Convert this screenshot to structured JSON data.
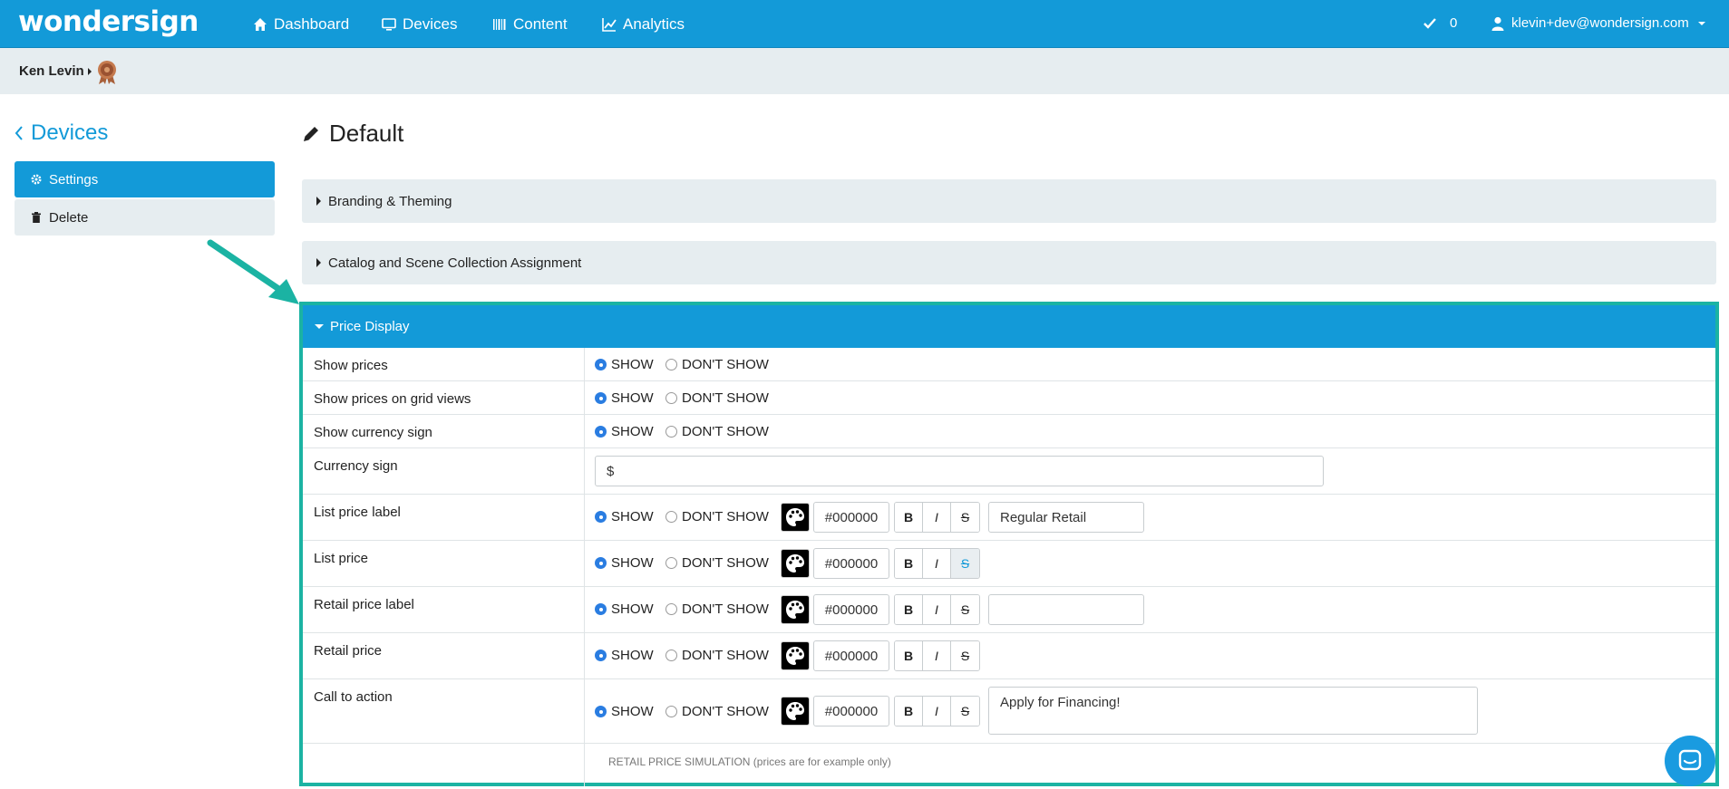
{
  "brand": {
    "logo": "wondersign",
    "accent": "#139ad8",
    "highlight": "#1bb3a3"
  },
  "nav": {
    "items": [
      {
        "label": "Dashboard",
        "icon": "home-icon"
      },
      {
        "label": "Devices",
        "icon": "monitor-icon"
      },
      {
        "label": "Content",
        "icon": "barcode-icon"
      },
      {
        "label": "Analytics",
        "icon": "chart-icon"
      }
    ],
    "notifications_count": "0",
    "user_email": "klevin+dev@wondersign.com"
  },
  "subbar": {
    "user_name": "Ken Levin"
  },
  "sidebar": {
    "back_label": "Devices",
    "items": [
      {
        "label": "Settings",
        "icon": "gear-icon"
      },
      {
        "label": "Delete",
        "icon": "trash-icon"
      }
    ]
  },
  "main": {
    "title": "Default",
    "panels": [
      {
        "label": "Branding & Theming"
      },
      {
        "label": "Catalog and Scene Collection Assignment"
      }
    ],
    "price_display": {
      "label": "Price Display",
      "show_label": "SHOW",
      "hide_label": "DON'T SHOW",
      "rows": [
        {
          "label": "Show prices",
          "value": "SHOW"
        },
        {
          "label": "Show prices on grid views",
          "value": "SHOW"
        },
        {
          "label": "Show currency sign",
          "value": "SHOW"
        },
        {
          "label": "Currency sign",
          "input_value": "$"
        },
        {
          "label": "List price label",
          "value": "SHOW",
          "color": "#000000",
          "text": "Regular Retail"
        },
        {
          "label": "List price",
          "value": "SHOW",
          "color": "#000000",
          "strike_active": true
        },
        {
          "label": "Retail price label",
          "value": "SHOW",
          "color": "#000000",
          "text": ""
        },
        {
          "label": "Retail price",
          "value": "SHOW",
          "color": "#000000"
        },
        {
          "label": "Call to action",
          "value": "SHOW",
          "color": "#000000",
          "text": "Apply for Financing!"
        }
      ],
      "format_buttons": {
        "bold": "B",
        "italic": "I",
        "strike": "S"
      },
      "simulation_note": "RETAIL PRICE SIMULATION (prices are for example only)"
    }
  }
}
